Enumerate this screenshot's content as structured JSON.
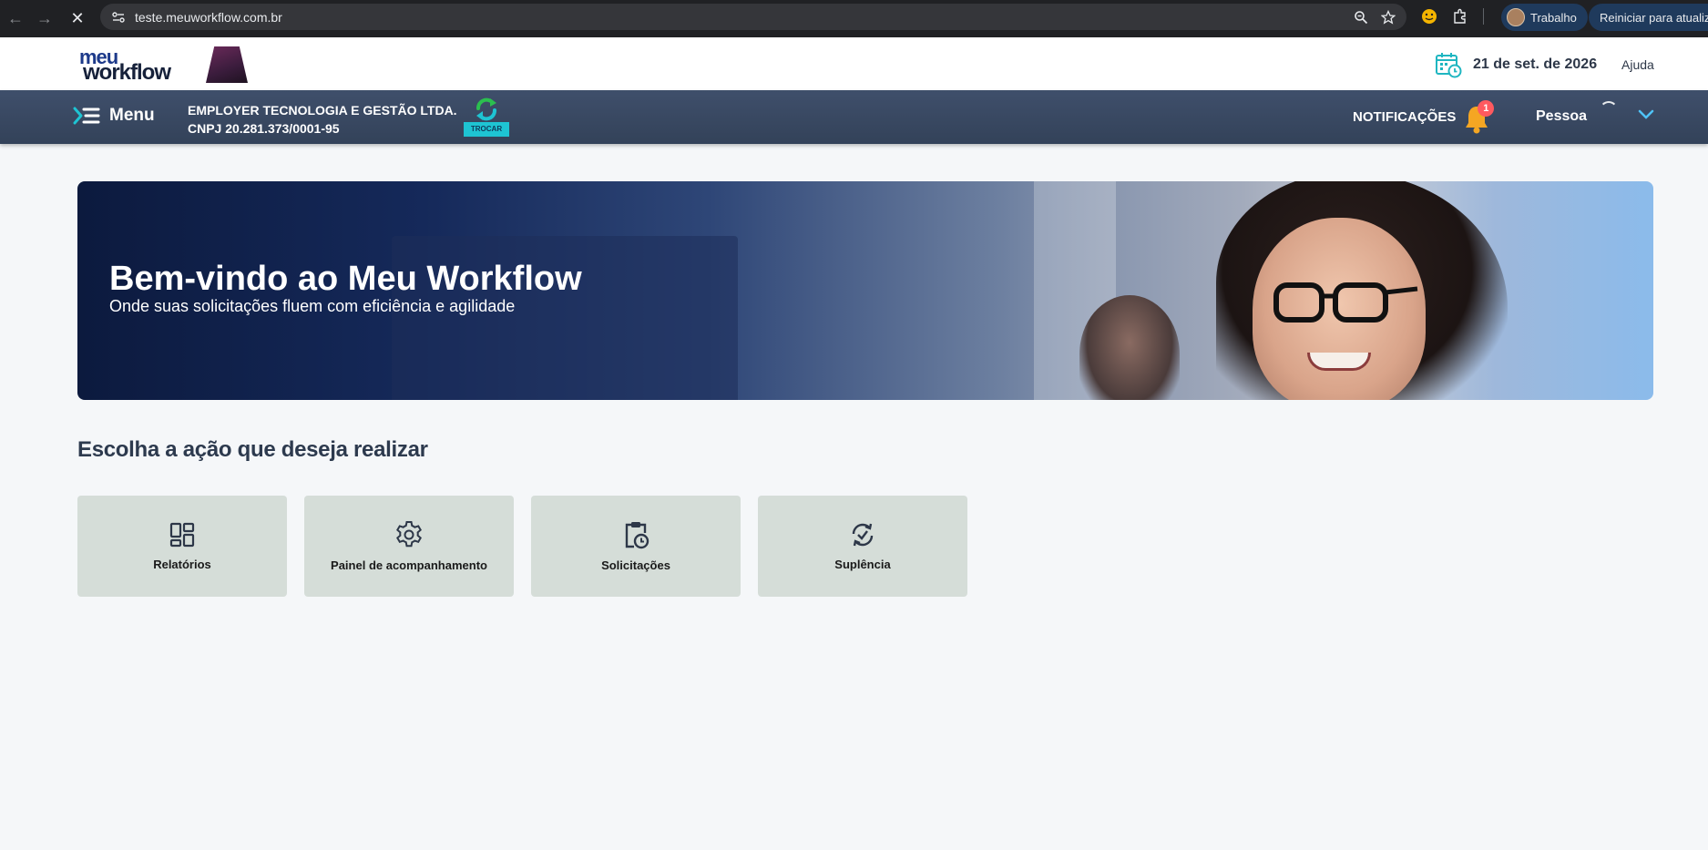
{
  "browser": {
    "url": "teste.meuworkflow.com.br",
    "profile_label": "Trabalho",
    "update_label": "Reiniciar para atualizar"
  },
  "header": {
    "logo_top": "meu",
    "logo_bottom": "workflow",
    "date": "21 de set. de 2026",
    "help_label": "Ajuda"
  },
  "navbar": {
    "menu_label": "Menu",
    "company_name": "EMPLOYER TECNOLOGIA E GESTÃO LTDA.",
    "company_cnpj": "CNPJ 20.281.373/0001-95",
    "switch_label": "TROCAR",
    "notifications_label": "NOTIFICAÇÕES",
    "notifications_count": "1",
    "user_label": "Pessoa"
  },
  "banner": {
    "title": "Bem-vindo ao Meu Workflow",
    "subtitle": "Onde suas solicitações fluem com eficiência e agilidade"
  },
  "actions": {
    "title": "Escolha a ação que deseja realizar",
    "items": [
      {
        "label": "Relatórios",
        "icon": "dashboard-icon"
      },
      {
        "label": "Painel de acompanhamento",
        "icon": "gear-icon"
      },
      {
        "label": "Solicitações",
        "icon": "clipboard-clock-icon"
      },
      {
        "label": "Suplência",
        "icon": "sync-check-icon"
      }
    ]
  },
  "colors": {
    "navbar": "#3a4a64",
    "accent_cyan": "#1ec4d3",
    "badge_red": "#ff5a5f",
    "card_bg": "#d5ddd8",
    "bell_orange": "#f5a623"
  }
}
